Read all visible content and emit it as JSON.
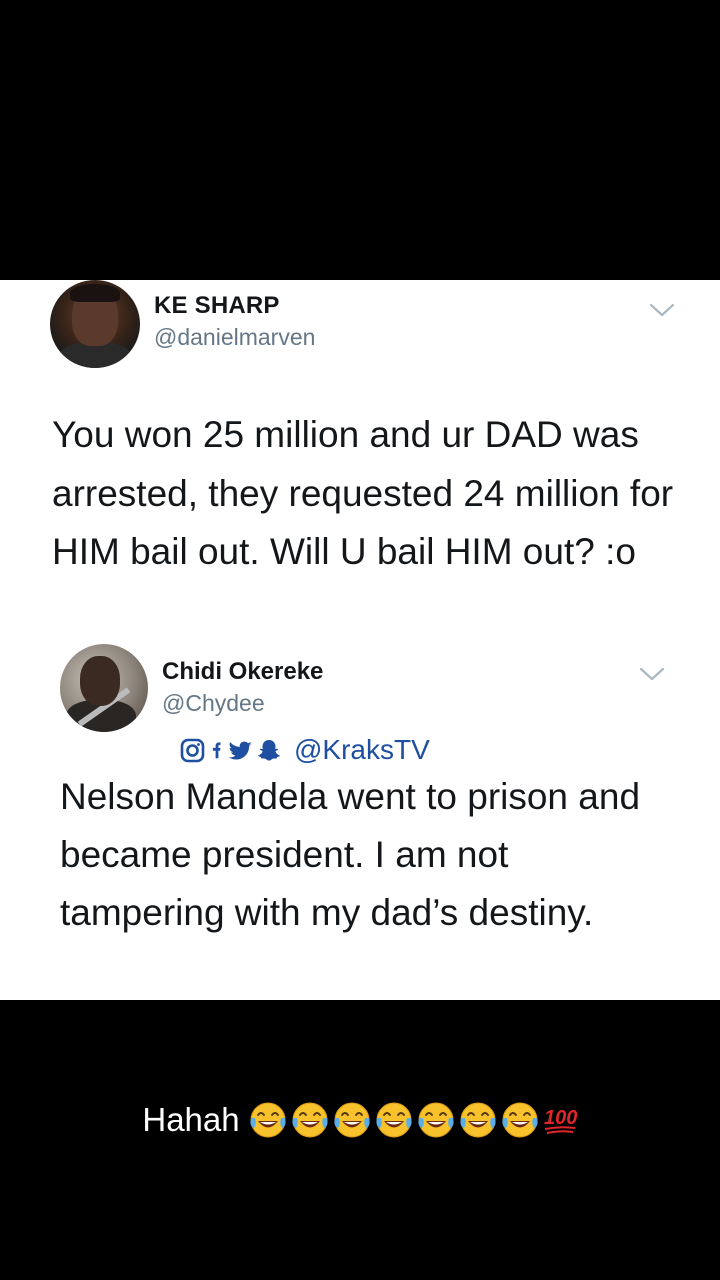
{
  "tweet1": {
    "name": "KE SHARP",
    "handle": "@danielmarven",
    "text": "You won 25 million and ur DAD was arrested, they requested 24 million for HIM bail out. Will U bail HIM out? :o"
  },
  "tweet2": {
    "name": "Chidi Okereke",
    "handle": "@Chydee",
    "social_handle": "@KraksTV",
    "social_icons": [
      "instagram-icon",
      "facebook-icon",
      "twitter-icon",
      "snapchat-icon"
    ],
    "text": "Nelson Mandela went to prison and became president. I am not tampering with my dad’s destiny."
  },
  "caption": {
    "text": "Hahah",
    "emojis": [
      "face-with-tears-of-joy",
      "face-with-tears-of-joy",
      "face-with-tears-of-joy",
      "face-with-tears-of-joy",
      "face-with-tears-of-joy",
      "face-with-tears-of-joy",
      "face-with-tears-of-joy",
      "hundred-points"
    ]
  },
  "colors": {
    "background": "#000000",
    "card": "#ffffff",
    "text_primary": "#14171a",
    "text_secondary": "#657786",
    "social_blue": "#1e4fa0"
  }
}
